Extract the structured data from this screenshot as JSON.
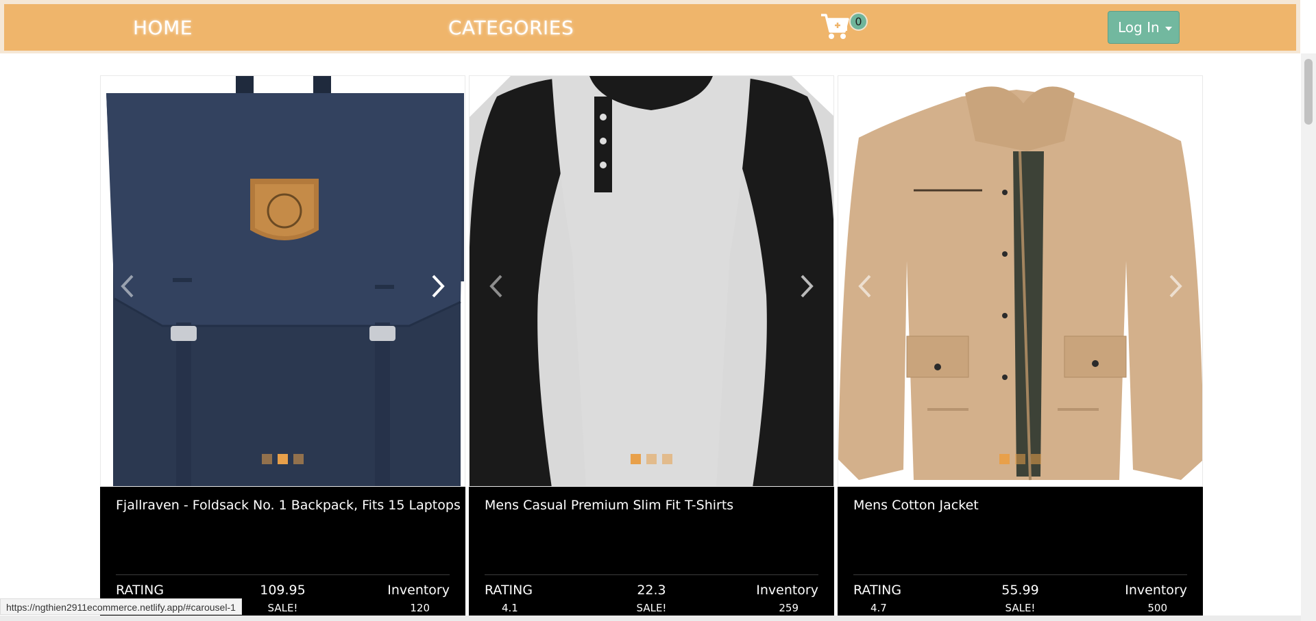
{
  "nav": {
    "home_label": "HOME",
    "categories_label": "CATEGORIES",
    "cart_count": "0",
    "login_label": "Log In"
  },
  "products": [
    {
      "title": "Fjallraven - Foldsack No. 1 Backpack, Fits 15 Laptops",
      "rating_label": "RATING",
      "rating": "",
      "price": "109.95",
      "sale": "SALE!",
      "inventory_label": "Inventory",
      "inventory": "120",
      "image": "navy-backpack",
      "active_slide": 2
    },
    {
      "title": "Mens Casual Premium Slim Fit T-Shirts",
      "rating_label": "RATING",
      "rating": "4.1",
      "price": "22.3",
      "sale": "SALE!",
      "inventory_label": "Inventory",
      "inventory": "259",
      "image": "raglan-tshirt",
      "active_slide": 1
    },
    {
      "title": "Mens Cotton Jacket",
      "rating_label": "RATING",
      "rating": "4.7",
      "price": "55.99",
      "sale": "SALE!",
      "inventory_label": "Inventory",
      "inventory": "500",
      "image": "khaki-jacket",
      "active_slide": 1
    }
  ],
  "status_bar": {
    "url": "https://ngthien2911ecommerce.netlify.app/#carousel-1"
  },
  "colors": {
    "navbar": "#efb56b",
    "login_button": "#72b89f",
    "card_footer": "#000000",
    "carousel_dot": "#e8a04a"
  }
}
